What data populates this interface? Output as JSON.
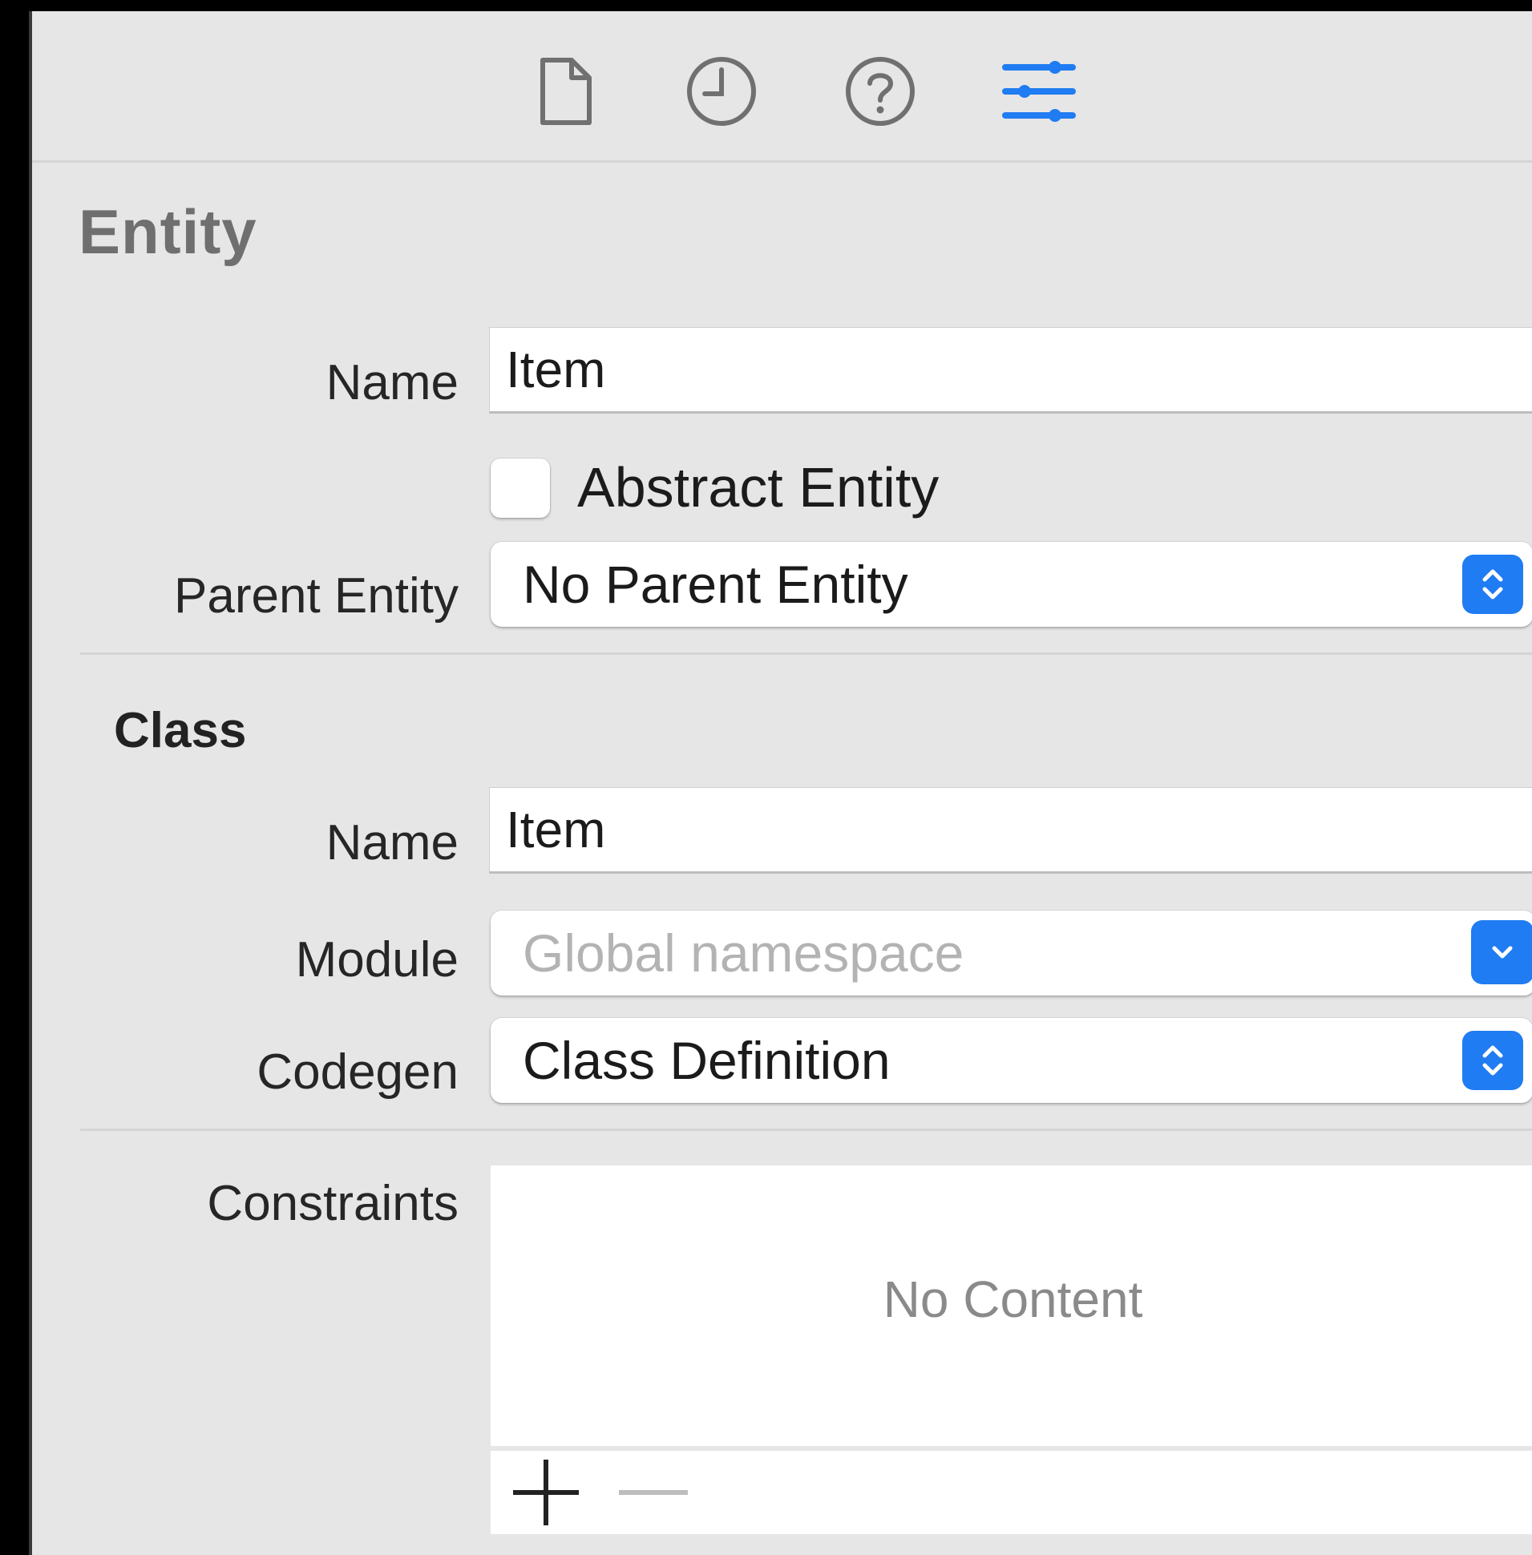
{
  "toolbar": {
    "icons": [
      {
        "name": "file-inspector-icon",
        "selected": false
      },
      {
        "name": "history-inspector-icon",
        "selected": false
      },
      {
        "name": "quick-help-icon",
        "selected": false
      },
      {
        "name": "attributes-inspector-icon",
        "selected": true
      }
    ],
    "accent_color": "#1f7cf2",
    "icon_color": "#707070"
  },
  "entity": {
    "section_title": "Entity",
    "name_label": "Name",
    "name_value": "Item",
    "abstract_label": "Abstract Entity",
    "abstract_checked": false,
    "parent_label": "Parent Entity",
    "parent_value": "No Parent Entity"
  },
  "class": {
    "section_title": "Class",
    "name_label": "Name",
    "name_value": "Item",
    "module_label": "Module",
    "module_placeholder": "Global namespace",
    "codegen_label": "Codegen",
    "codegen_value": "Class Definition"
  },
  "constraints": {
    "label": "Constraints",
    "empty_text": "No Content",
    "add_icon": "plus-icon",
    "remove_icon": "minus-icon"
  }
}
